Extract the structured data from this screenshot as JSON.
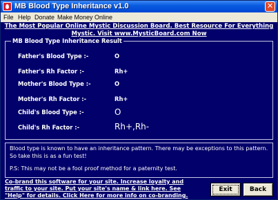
{
  "window": {
    "title": "MB Blood Type Inheritance v1.0",
    "close_glyph": "✕"
  },
  "menu": [
    "File",
    "Help",
    "Donate",
    "Make Money Online"
  ],
  "banner": {
    "line1": "The Most Popular Online Mystic Discussion Board. Best Resource For Everything",
    "line2": "Mystic. Visit www.MysticBoard.com Now"
  },
  "result": {
    "title": "MB Blood Type Inheritance Result",
    "rows": [
      {
        "label": "Father's Blood Type :-",
        "value": "O"
      },
      {
        "label": "Father's Rh Factor :-",
        "value": "Rh+"
      },
      {
        "label": "Mother's Blood Type :-",
        "value": "O"
      },
      {
        "label": "Mother's Rh Factor :-",
        "value": "Rh+"
      },
      {
        "label": "Child's Blood Type :-",
        "value": "O"
      },
      {
        "label": "Child's Rh Factor :-",
        "value": "Rh+,Rh-"
      }
    ]
  },
  "info": {
    "paragraph1": "Blood type is known to have an inheritance pattern. There may be exceptions to this pattern. So take this is as a fun test!",
    "paragraph2": "P.S: This may not be a fool proof method for a paternity test."
  },
  "cobrand": {
    "line1": "Co-brand this software for your site. Increase loyalty and",
    "line2": "traffic to your site. Put your site's name & link here. See",
    "line3": "\"Help\" for details.   Click Here for more info on co-branding."
  },
  "buttons": {
    "exit": "Exit",
    "back": "Back"
  }
}
